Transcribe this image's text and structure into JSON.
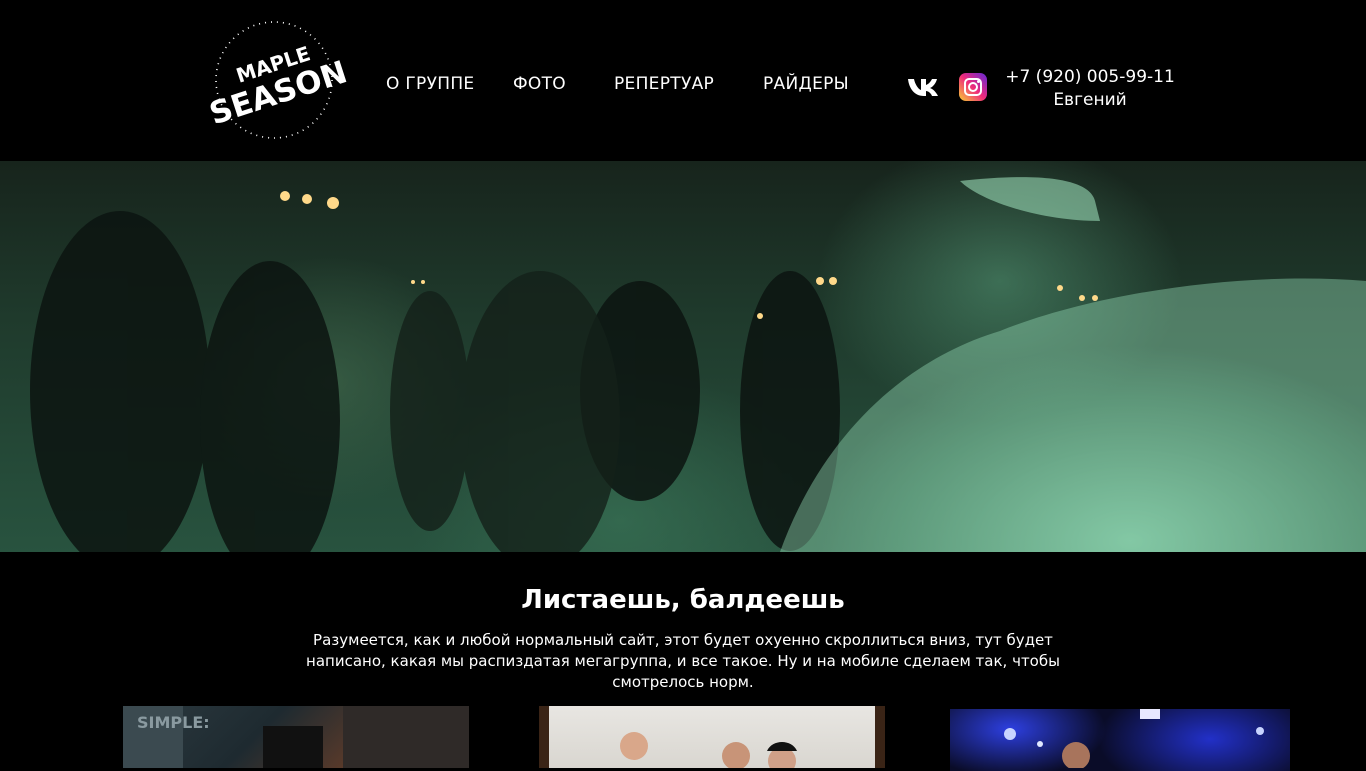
{
  "header": {
    "logo_line1": "MAPLE",
    "logo_line2": "SEASON",
    "nav": [
      {
        "label": "О ГРУППЕ"
      },
      {
        "label": "ФОТО"
      },
      {
        "label": "РЕПЕРТУАР"
      },
      {
        "label": "РАЙДЕРЫ"
      }
    ],
    "social": [
      {
        "icon": "vk-icon"
      },
      {
        "icon": "instagram-icon"
      }
    ],
    "phone": "+7 (920) 005-99-11",
    "contact_name": "Евгений"
  },
  "hero": {
    "image": "concert-crowd-photo"
  },
  "intro": {
    "title": "Листаешь, балдеешь",
    "text": "Разумеется, как и любой нормальный сайт, этот будет охуенно скроллиться вниз, тут будет написано, какая мы распиздатая мегагруппа, и все такое. Ну и на мобиле сделаем так, чтобы смотрелось норм."
  },
  "gallery": [
    {
      "image": "band-photo-1",
      "sign_text": "SIMPLE:"
    },
    {
      "image": "band-photo-2"
    },
    {
      "image": "band-photo-3"
    }
  ],
  "colors": {
    "background": "#000000",
    "text": "#ffffff",
    "hero_tint": "#2f6b50"
  }
}
